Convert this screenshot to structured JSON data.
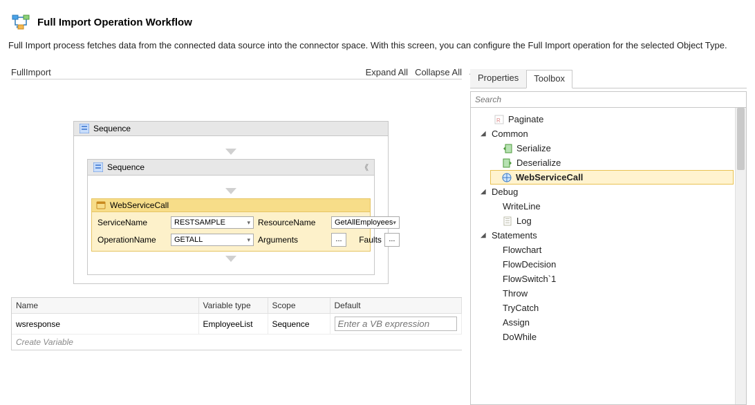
{
  "header": {
    "title": "Full Import Operation Workflow",
    "description": "Full Import process fetches data from the connected data source into the connector space. With this screen, you can configure the Full Import operation for the selected Object Type."
  },
  "designer": {
    "name": "FullImport",
    "expand_all": "Expand All",
    "collapse_all": "Collapse All",
    "outer_seq_label": "Sequence",
    "inner_seq_label": "Sequence",
    "wscall": {
      "title": "WebServiceCall",
      "labels": {
        "service_name": "ServiceName",
        "resource_name": "ResourceName",
        "operation_name": "OperationName",
        "arguments": "Arguments",
        "faults": "Faults"
      },
      "values": {
        "service_name": "RESTSAMPLE",
        "resource_name": "GetAllEmployees",
        "operation_name": "GETALL"
      }
    }
  },
  "variables": {
    "headers": {
      "name": "Name",
      "type": "Variable type",
      "scope": "Scope",
      "default": "Default"
    },
    "rows": [
      {
        "name": "wsresponse",
        "type": "EmployeeList",
        "scope": "Sequence",
        "default_placeholder": "Enter a VB expression"
      }
    ],
    "create_label": "Create Variable"
  },
  "right": {
    "tabs": {
      "properties": "Properties",
      "toolbox": "Toolbox"
    },
    "search_placeholder": "Search",
    "nodes": {
      "paginate": "Paginate",
      "common": "Common",
      "serialize": "Serialize",
      "deserialize": "Deserialize",
      "webservicecall": "WebServiceCall",
      "debug": "Debug",
      "writeline": "WriteLine",
      "log": "Log",
      "statements": "Statements",
      "flowchart": "Flowchart",
      "flowdecision": "FlowDecision",
      "flowswitch": "FlowSwitch`1",
      "throw": "Throw",
      "trycatch": "TryCatch",
      "assign": "Assign",
      "dowhile": "DoWhile"
    }
  }
}
